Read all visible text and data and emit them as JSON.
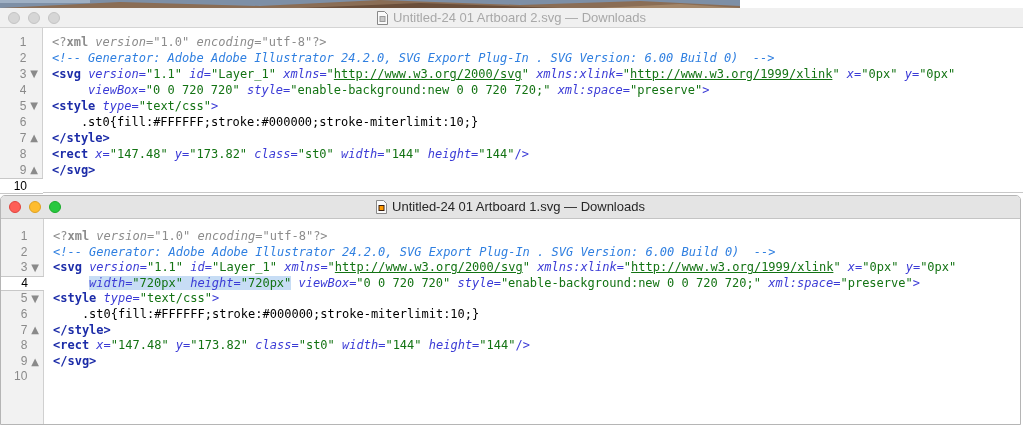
{
  "windows": [
    {
      "title": "Untitled-24 01 Artboard 2.svg — Downloads",
      "active": false,
      "lines": [
        {
          "number": "1",
          "current": false,
          "indented": false,
          "tokens": [
            {
              "kind": "pi",
              "text": "<?"
            },
            {
              "kind": "pi_name",
              "text": "xml"
            },
            {
              "kind": "pi_attr",
              "text": " version"
            },
            {
              "kind": "pi",
              "text": "=\"1.0\""
            },
            {
              "kind": "pi_attr",
              "text": " encoding"
            },
            {
              "kind": "pi",
              "text": "=\"utf-8\"?>"
            }
          ]
        },
        {
          "number": "2",
          "current": false,
          "indented": false,
          "tokens": [
            {
              "kind": "comment",
              "text": "<!-- Generator: Adobe Adobe Illustrator 24.2.0, SVG Export Plug-In . SVG Version: 6.00 Build 0)  -->"
            }
          ]
        },
        {
          "number": "3",
          "current": false,
          "indented": false,
          "fold_marker": "▼",
          "tokens": [
            {
              "kind": "tag",
              "text": "<svg"
            },
            {
              "kind": "attr",
              "text": " version"
            },
            {
              "kind": "punct",
              "text": "="
            },
            {
              "kind": "value",
              "text": "\"1.1\""
            },
            {
              "kind": "attr",
              "text": " id"
            },
            {
              "kind": "punct",
              "text": "="
            },
            {
              "kind": "value",
              "text": "\"Layer_1\""
            },
            {
              "kind": "attr",
              "text": " xmlns"
            },
            {
              "kind": "punct",
              "text": "="
            },
            {
              "kind": "value",
              "text": "\""
            },
            {
              "kind": "link",
              "text": "http://www.w3.org/2000/svg"
            },
            {
              "kind": "value",
              "text": "\""
            },
            {
              "kind": "attr",
              "text": " xmlns:xlink"
            },
            {
              "kind": "punct",
              "text": "="
            },
            {
              "kind": "value",
              "text": "\""
            },
            {
              "kind": "link",
              "text": "http://www.w3.org/1999/xlink"
            },
            {
              "kind": "value",
              "text": "\""
            },
            {
              "kind": "attr",
              "text": " x"
            },
            {
              "kind": "punct",
              "text": "="
            },
            {
              "kind": "value",
              "text": "\"0px\""
            },
            {
              "kind": "attr",
              "text": " y"
            },
            {
              "kind": "punct",
              "text": "="
            },
            {
              "kind": "value",
              "text": "\"0px\""
            }
          ]
        },
        {
          "number": "4",
          "current": false,
          "indented": true,
          "tokens": [
            {
              "kind": "attr",
              "text": "viewBox"
            },
            {
              "kind": "punct",
              "text": "="
            },
            {
              "kind": "value",
              "text": "\"0 0 720 720\""
            },
            {
              "kind": "attr",
              "text": " style"
            },
            {
              "kind": "punct",
              "text": "="
            },
            {
              "kind": "value",
              "text": "\"enable-background:new 0 0 720 720;\""
            },
            {
              "kind": "attr",
              "text": " xml:space"
            },
            {
              "kind": "punct",
              "text": "="
            },
            {
              "kind": "value",
              "text": "\"preserve\""
            },
            {
              "kind": "punct",
              "text": ">"
            }
          ]
        },
        {
          "number": "5",
          "current": false,
          "indented": false,
          "fold_marker": "▼",
          "tokens": [
            {
              "kind": "tag",
              "text": "<style"
            },
            {
              "kind": "attr",
              "text": " type"
            },
            {
              "kind": "punct",
              "text": "="
            },
            {
              "kind": "value",
              "text": "\"text/css\""
            },
            {
              "kind": "punct",
              "text": ">"
            }
          ]
        },
        {
          "number": "6",
          "current": false,
          "indented": false,
          "tokens": [
            {
              "kind": "text",
              "text": "    .st0{fill:#FFFFFF;stroke:#000000;stroke-miterlimit:10;}"
            }
          ]
        },
        {
          "number": "7",
          "current": false,
          "indented": false,
          "fold_marker": "▲",
          "tokens": [
            {
              "kind": "tag",
              "text": "</style>"
            }
          ]
        },
        {
          "number": "8",
          "current": false,
          "indented": false,
          "tokens": [
            {
              "kind": "tag",
              "text": "<rect"
            },
            {
              "kind": "attr",
              "text": " x"
            },
            {
              "kind": "punct",
              "text": "="
            },
            {
              "kind": "value",
              "text": "\"147.48\""
            },
            {
              "kind": "attr",
              "text": " y"
            },
            {
              "kind": "punct",
              "text": "="
            },
            {
              "kind": "value",
              "text": "\"173.82\""
            },
            {
              "kind": "attr",
              "text": " class"
            },
            {
              "kind": "punct",
              "text": "="
            },
            {
              "kind": "value",
              "text": "\"st0\""
            },
            {
              "kind": "attr",
              "text": " width"
            },
            {
              "kind": "punct",
              "text": "="
            },
            {
              "kind": "value",
              "text": "\"144\""
            },
            {
              "kind": "attr",
              "text": " height"
            },
            {
              "kind": "punct",
              "text": "="
            },
            {
              "kind": "value",
              "text": "\"144\""
            },
            {
              "kind": "punct",
              "text": "/>"
            }
          ]
        },
        {
          "number": "9",
          "current": false,
          "indented": false,
          "fold_marker": "▲",
          "tokens": [
            {
              "kind": "tag",
              "text": "</svg>"
            }
          ]
        },
        {
          "number": "10",
          "current": true
        }
      ]
    },
    {
      "title": "Untitled-24 01 Artboard 1.svg — Downloads",
      "active": true,
      "lines": [
        {
          "number": "1",
          "current": false,
          "indented": false,
          "tokens": [
            {
              "kind": "pi",
              "text": "<?"
            },
            {
              "kind": "pi_name",
              "text": "xml"
            },
            {
              "kind": "pi_attr",
              "text": " version"
            },
            {
              "kind": "pi",
              "text": "=\"1.0\""
            },
            {
              "kind": "pi_attr",
              "text": " encoding"
            },
            {
              "kind": "pi",
              "text": "=\"utf-8\"?>"
            }
          ]
        },
        {
          "number": "2",
          "current": false,
          "indented": false,
          "tokens": [
            {
              "kind": "comment",
              "text": "<!-- Generator: Adobe Adobe Illustrator 24.2.0, SVG Export Plug-In . SVG Version: 6.00 Build 0)  -->"
            }
          ]
        },
        {
          "number": "3",
          "current": false,
          "indented": false,
          "fold_marker": "▼",
          "tokens": [
            {
              "kind": "tag",
              "text": "<svg"
            },
            {
              "kind": "attr",
              "text": " version"
            },
            {
              "kind": "punct",
              "text": "="
            },
            {
              "kind": "value",
              "text": "\"1.1\""
            },
            {
              "kind": "attr",
              "text": " id"
            },
            {
              "kind": "punct",
              "text": "="
            },
            {
              "kind": "value",
              "text": "\"Layer_1\""
            },
            {
              "kind": "attr",
              "text": " xmlns"
            },
            {
              "kind": "punct",
              "text": "="
            },
            {
              "kind": "value",
              "text": "\""
            },
            {
              "kind": "link",
              "text": "http://www.w3.org/2000/svg"
            },
            {
              "kind": "value",
              "text": "\""
            },
            {
              "kind": "attr",
              "text": " xmlns:xlink"
            },
            {
              "kind": "punct",
              "text": "="
            },
            {
              "kind": "value",
              "text": "\""
            },
            {
              "kind": "link",
              "text": "http://www.w3.org/1999/xlink"
            },
            {
              "kind": "value",
              "text": "\""
            },
            {
              "kind": "attr",
              "text": " x"
            },
            {
              "kind": "punct",
              "text": "="
            },
            {
              "kind": "value",
              "text": "\"0px\""
            },
            {
              "kind": "attr",
              "text": " y"
            },
            {
              "kind": "punct",
              "text": "="
            },
            {
              "kind": "value",
              "text": "\"0px\""
            }
          ]
        },
        {
          "number": "4",
          "current": true,
          "indented": true,
          "tokens": [
            {
              "kind": "selection",
              "selected": true,
              "tokens": [
                {
                  "kind": "attr",
                  "text": "width"
                },
                {
                  "kind": "punct",
                  "text": "="
                },
                {
                  "kind": "value",
                  "text": "\"720px\""
                },
                {
                  "kind": "attr",
                  "text": " height"
                },
                {
                  "kind": "punct",
                  "text": "="
                },
                {
                  "kind": "value",
                  "text": "\"720px\""
                }
              ]
            },
            {
              "kind": "attr",
              "text": " viewBox"
            },
            {
              "kind": "punct",
              "text": "="
            },
            {
              "kind": "value",
              "text": "\"0 0 720 720\""
            },
            {
              "kind": "attr",
              "text": " style"
            },
            {
              "kind": "punct",
              "text": "="
            },
            {
              "kind": "value",
              "text": "\"enable-background:new 0 0 720 720;\""
            },
            {
              "kind": "attr",
              "text": " xml:space"
            },
            {
              "kind": "punct",
              "text": "="
            },
            {
              "kind": "value",
              "text": "\"preserve\""
            },
            {
              "kind": "punct",
              "text": ">"
            }
          ]
        },
        {
          "number": "5",
          "current": false,
          "indented": false,
          "fold_marker": "▼",
          "tokens": [
            {
              "kind": "tag",
              "text": "<style"
            },
            {
              "kind": "attr",
              "text": " type"
            },
            {
              "kind": "punct",
              "text": "="
            },
            {
              "kind": "value",
              "text": "\"text/css\""
            },
            {
              "kind": "punct",
              "text": ">"
            }
          ]
        },
        {
          "number": "6",
          "current": false,
          "indented": false,
          "tokens": [
            {
              "kind": "text",
              "text": "    .st0{fill:#FFFFFF;stroke:#000000;stroke-miterlimit:10;}"
            }
          ]
        },
        {
          "number": "7",
          "current": false,
          "indented": false,
          "fold_marker": "▲",
          "tokens": [
            {
              "kind": "tag",
              "text": "</style>"
            }
          ]
        },
        {
          "number": "8",
          "current": false,
          "indented": false,
          "tokens": [
            {
              "kind": "tag",
              "text": "<rect"
            },
            {
              "kind": "attr",
              "text": " x"
            },
            {
              "kind": "punct",
              "text": "="
            },
            {
              "kind": "value",
              "text": "\"147.48\""
            },
            {
              "kind": "attr",
              "text": " y"
            },
            {
              "kind": "punct",
              "text": "="
            },
            {
              "kind": "value",
              "text": "\"173.82\""
            },
            {
              "kind": "attr",
              "text": " class"
            },
            {
              "kind": "punct",
              "text": "="
            },
            {
              "kind": "value",
              "text": "\"st0\""
            },
            {
              "kind": "attr",
              "text": " width"
            },
            {
              "kind": "punct",
              "text": "="
            },
            {
              "kind": "value",
              "text": "\"144\""
            },
            {
              "kind": "attr",
              "text": " height"
            },
            {
              "kind": "punct",
              "text": "="
            },
            {
              "kind": "value",
              "text": "\"144\""
            },
            {
              "kind": "punct",
              "text": "/>"
            }
          ]
        },
        {
          "number": "9",
          "current": false,
          "indented": false,
          "fold_marker": "▲",
          "tokens": [
            {
              "kind": "tag",
              "text": "</svg>"
            }
          ]
        },
        {
          "number": "10",
          "current": false
        }
      ]
    }
  ]
}
